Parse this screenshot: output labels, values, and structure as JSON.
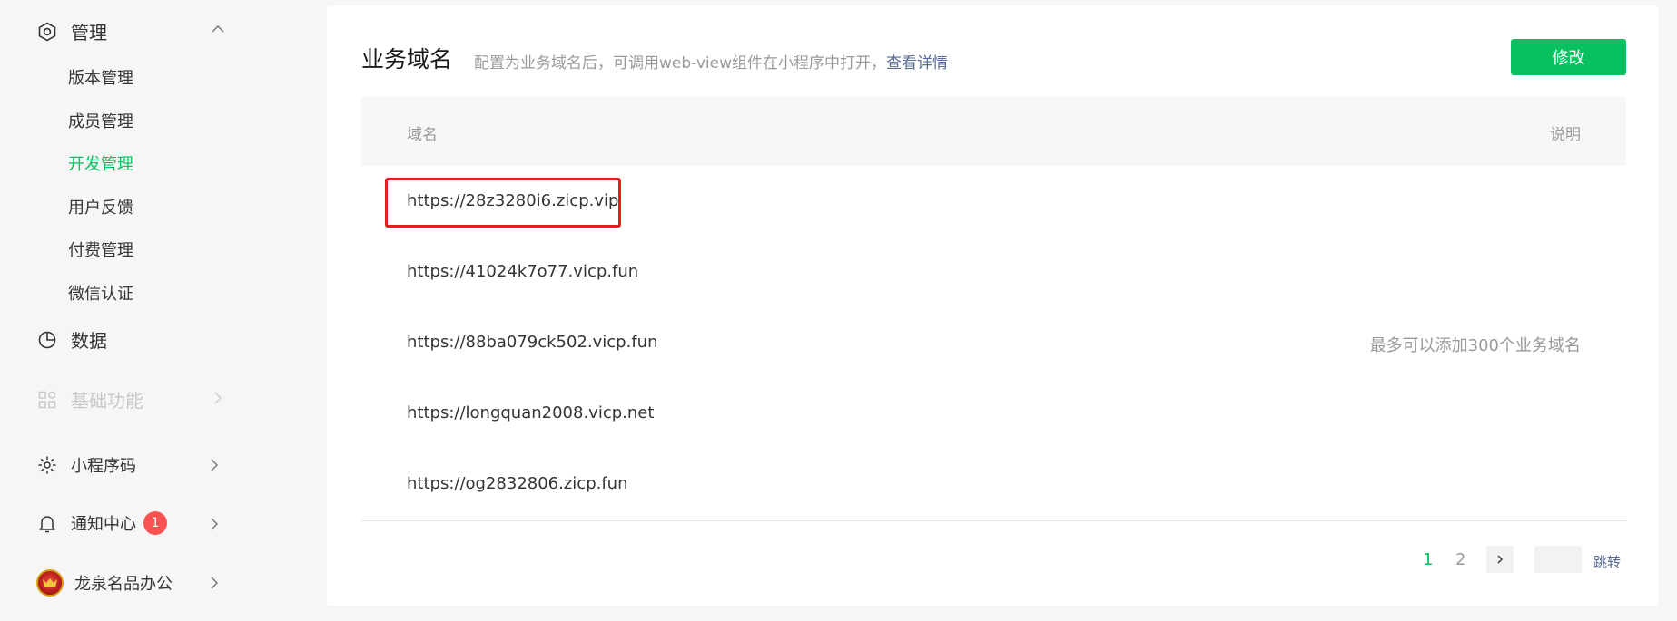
{
  "sidebar": {
    "manage": {
      "label": "管理",
      "items": [
        {
          "label": "版本管理"
        },
        {
          "label": "成员管理"
        },
        {
          "label": "开发管理",
          "active": true
        },
        {
          "label": "用户反馈"
        },
        {
          "label": "付费管理"
        },
        {
          "label": "微信认证"
        }
      ]
    },
    "data": {
      "label": "数据"
    },
    "basic": {
      "label": "基础功能"
    },
    "qrcode": {
      "label": "小程序码"
    },
    "notify": {
      "label": "通知中心",
      "badge": "1"
    },
    "account": {
      "label": "龙泉名品办公"
    }
  },
  "main": {
    "title": "业务域名",
    "description": "配置为业务域名后，可调用web-view组件在小程序中打开，",
    "detail_link": "查看详情",
    "edit_button": "修改",
    "table": {
      "columns": {
        "domain": "域名",
        "desc": "说明"
      },
      "rows": [
        {
          "domain": "https://28z3280i6.zicp.vip",
          "desc": ""
        },
        {
          "domain": "https://41024k7o77.vicp.fun",
          "desc": ""
        },
        {
          "domain": "https://88ba079ck502.vicp.fun",
          "desc": "最多可以添加300个业务域名"
        },
        {
          "domain": "https://longquan2008.vicp.net",
          "desc": ""
        },
        {
          "domain": "https://og2832806.zicp.fun",
          "desc": ""
        }
      ]
    },
    "pagination": {
      "pages": [
        "1",
        "2"
      ],
      "current": "1",
      "jump_label": "跳转",
      "input_value": ""
    }
  },
  "colors": {
    "accent": "#07c160",
    "link": "#576b95",
    "highlight": "#e02020",
    "badge": "#fa5151"
  }
}
